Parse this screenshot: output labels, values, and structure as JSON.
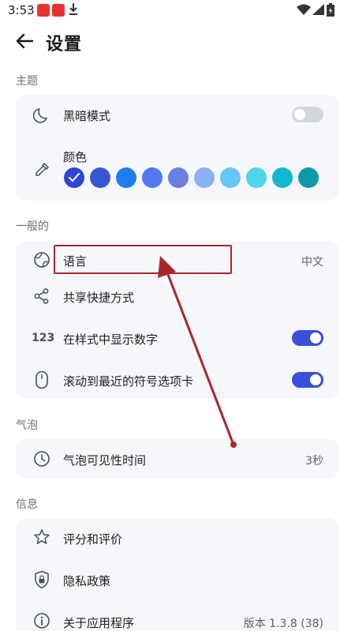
{
  "status_bar": {
    "time": "3:53"
  },
  "header": {
    "title": "设置"
  },
  "sections": {
    "theme": {
      "label": "主题",
      "dark_mode_label": "黑暗模式",
      "color_label": "颜色",
      "dark_mode_on": false
    },
    "general": {
      "label": "一般的",
      "language_label": "语言",
      "language_value": "中文",
      "share_label": "共享快捷方式",
      "numbers_label": "在样式中显示数字",
      "numbers_icon_text": "123",
      "scroll_label": "滚动到最近的符号选项卡"
    },
    "bubble": {
      "label": "气泡",
      "visibility_label": "气泡可见性时间",
      "visibility_value": "3秒"
    },
    "info": {
      "label": "信息",
      "rate_label": "评分和评价",
      "privacy_label": "隐私政策",
      "about_label": "关于应用程序",
      "about_value": "版本 1.3.8 (38)"
    }
  },
  "colors": {
    "accent": "#3a4fd9",
    "swatches": [
      "#2f45d6",
      "#3457d5",
      "#1d7ef0",
      "#5378f0",
      "#6a7fe0",
      "#8ab0f5",
      "#67c5f5",
      "#4dd6e8",
      "#10b8cf",
      "#0d9aa8"
    ],
    "annotation": "#a8262b"
  },
  "icons": {
    "dark_mode": "moon-icon",
    "color": "eyedropper-icon",
    "language": "globe-icon",
    "share": "share-icon",
    "scroll": "mouse-icon",
    "bubble": "clock-icon",
    "rate": "star-icon",
    "privacy": "shield-lock-icon",
    "about": "info-icon"
  }
}
